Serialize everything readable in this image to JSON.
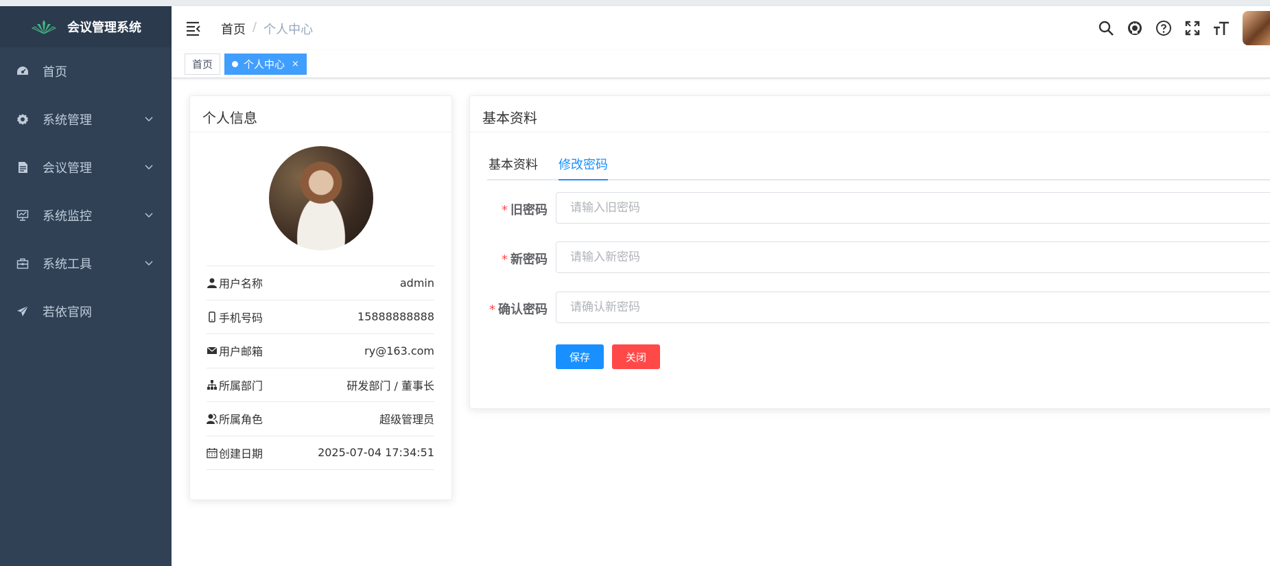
{
  "app": {
    "title": "会议管理系统"
  },
  "sidebar": {
    "items": [
      {
        "label": "首页",
        "icon": "dashboard-icon",
        "has_children": false
      },
      {
        "label": "系统管理",
        "icon": "gear-icon",
        "has_children": true
      },
      {
        "label": "会议管理",
        "icon": "document-icon",
        "has_children": true
      },
      {
        "label": "系统监控",
        "icon": "monitor-icon",
        "has_children": true
      },
      {
        "label": "系统工具",
        "icon": "toolbox-icon",
        "has_children": true
      },
      {
        "label": "若依官网",
        "icon": "send-icon",
        "has_children": false
      }
    ]
  },
  "navbar": {
    "breadcrumb": {
      "home": "首页",
      "separator": "/",
      "current": "个人中心"
    },
    "icons": [
      "search-icon",
      "github-icon",
      "help-icon",
      "fullscreen-icon",
      "font-size-icon"
    ]
  },
  "tags": [
    {
      "label": "首页",
      "active": false
    },
    {
      "label": "个人中心",
      "active": true,
      "close": "×"
    }
  ],
  "profile_card": {
    "title": "个人信息",
    "rows": [
      {
        "label": "用户名称",
        "value": "admin",
        "icon": "user-icon"
      },
      {
        "label": "手机号码",
        "value": "15888888888",
        "icon": "phone-icon"
      },
      {
        "label": "用户邮箱",
        "value": "ry@163.com",
        "icon": "mail-icon"
      },
      {
        "label": "所属部门",
        "value": "研发部门 / 董事长",
        "icon": "tree-icon"
      },
      {
        "label": "所属角色",
        "value": "超级管理员",
        "icon": "peoples-icon"
      },
      {
        "label": "创建日期",
        "value": "2025-07-04 17:34:51",
        "icon": "calendar-icon"
      }
    ]
  },
  "settings_card": {
    "title": "基本资料",
    "tabs": [
      {
        "label": "基本资料",
        "active": false
      },
      {
        "label": "修改密码",
        "active": true
      }
    ],
    "form": {
      "required_mark": "*",
      "old_password": {
        "label": "旧密码",
        "placeholder": "请输入旧密码",
        "value": ""
      },
      "new_password": {
        "label": "新密码",
        "placeholder": "请输入新密码",
        "value": ""
      },
      "confirm_password": {
        "label": "确认密码",
        "placeholder": "请确认新密码",
        "value": ""
      },
      "save_label": "保存",
      "close_label": "关闭"
    }
  },
  "colors": {
    "sidebar_bg": "#304156",
    "primary": "#1890ff",
    "danger": "#ff4949",
    "tag_active": "#409eff"
  }
}
